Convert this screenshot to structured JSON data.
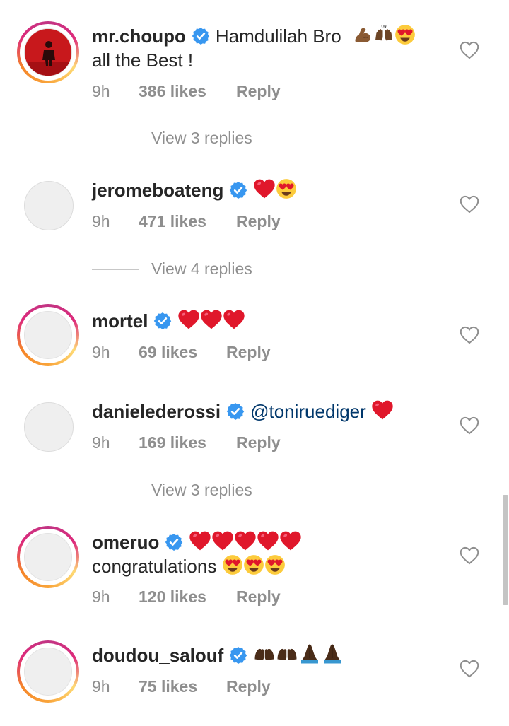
{
  "comments": [
    {
      "username": "mr.choupo",
      "verified": true,
      "text": "Hamdulilah Bro",
      "text2": "all the Best !",
      "time": "9h",
      "likes": "386 likes",
      "reply": "Reply",
      "view_replies": "View 3 replies"
    },
    {
      "username": "jeromeboateng",
      "verified": true,
      "text": "",
      "time": "9h",
      "likes": "471 likes",
      "reply": "Reply",
      "view_replies": "View 4 replies"
    },
    {
      "username": "mortel",
      "verified": true,
      "text": "",
      "time": "9h",
      "likes": "69 likes",
      "reply": "Reply"
    },
    {
      "username": "danielederossi",
      "verified": true,
      "mention": "@toniruediger",
      "time": "9h",
      "likes": "169 likes",
      "reply": "Reply",
      "view_replies": "View 3 replies"
    },
    {
      "username": "omeruo",
      "verified": true,
      "text2": "congratulations",
      "time": "9h",
      "likes": "120 likes",
      "reply": "Reply"
    },
    {
      "username": "doudou_salouf",
      "verified": true,
      "time": "9h",
      "likes": "75 likes",
      "reply": "Reply"
    }
  ],
  "colors": {
    "verified_blue": "#3897f0",
    "heart_red": "#e0172b",
    "meta_gray": "#8e8e8e",
    "mention_blue": "#00376b"
  },
  "icons": {
    "like": "heart-outline-icon",
    "verified": "verified-badge-icon"
  }
}
